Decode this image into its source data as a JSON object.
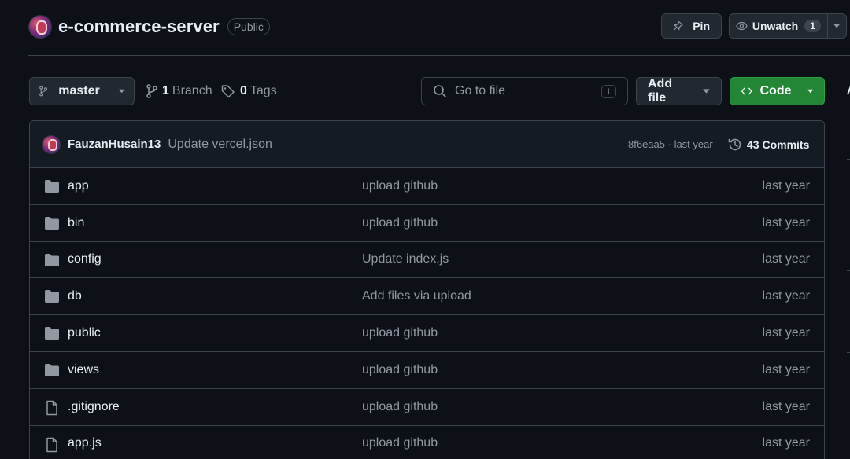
{
  "repo": {
    "name": "e-commerce-server",
    "visibility": "Public"
  },
  "actions": {
    "pin_label": "Pin",
    "watch_label": "Unwatch",
    "watch_count": "1"
  },
  "toolbar": {
    "branch_name": "master",
    "branch_count": "1",
    "branch_label": "Branch",
    "tag_count": "0",
    "tag_label": "Tags",
    "search_placeholder": "Go to file",
    "search_shortcut": "t",
    "add_file_label": "Add file",
    "code_label": "Code"
  },
  "latest_commit": {
    "author": "FauzanHusain13",
    "message": "Update vercel.json",
    "hash": "8f6eaa5",
    "time": "last year",
    "commit_count_label": "43 Commits"
  },
  "files": [
    {
      "name": "app",
      "type": "folder",
      "message": "upload github",
      "date": "last year"
    },
    {
      "name": "bin",
      "type": "folder",
      "message": "upload github",
      "date": "last year"
    },
    {
      "name": "config",
      "type": "folder",
      "message": "Update index.js",
      "date": "last year"
    },
    {
      "name": "db",
      "type": "folder",
      "message": "Add files via upload",
      "date": "last year"
    },
    {
      "name": "public",
      "type": "folder",
      "message": "upload github",
      "date": "last year"
    },
    {
      "name": "views",
      "type": "folder",
      "message": "upload github",
      "date": "last year"
    },
    {
      "name": ".gitignore",
      "type": "file",
      "message": "upload github",
      "date": "last year"
    },
    {
      "name": "app.js",
      "type": "file",
      "message": "upload github",
      "date": "last year"
    }
  ],
  "colors": {
    "background": "#0d1117",
    "border": "#3d444d",
    "code_button": "#238636",
    "muted_text": "#9198a1",
    "folder_icon": "#9198a1"
  }
}
